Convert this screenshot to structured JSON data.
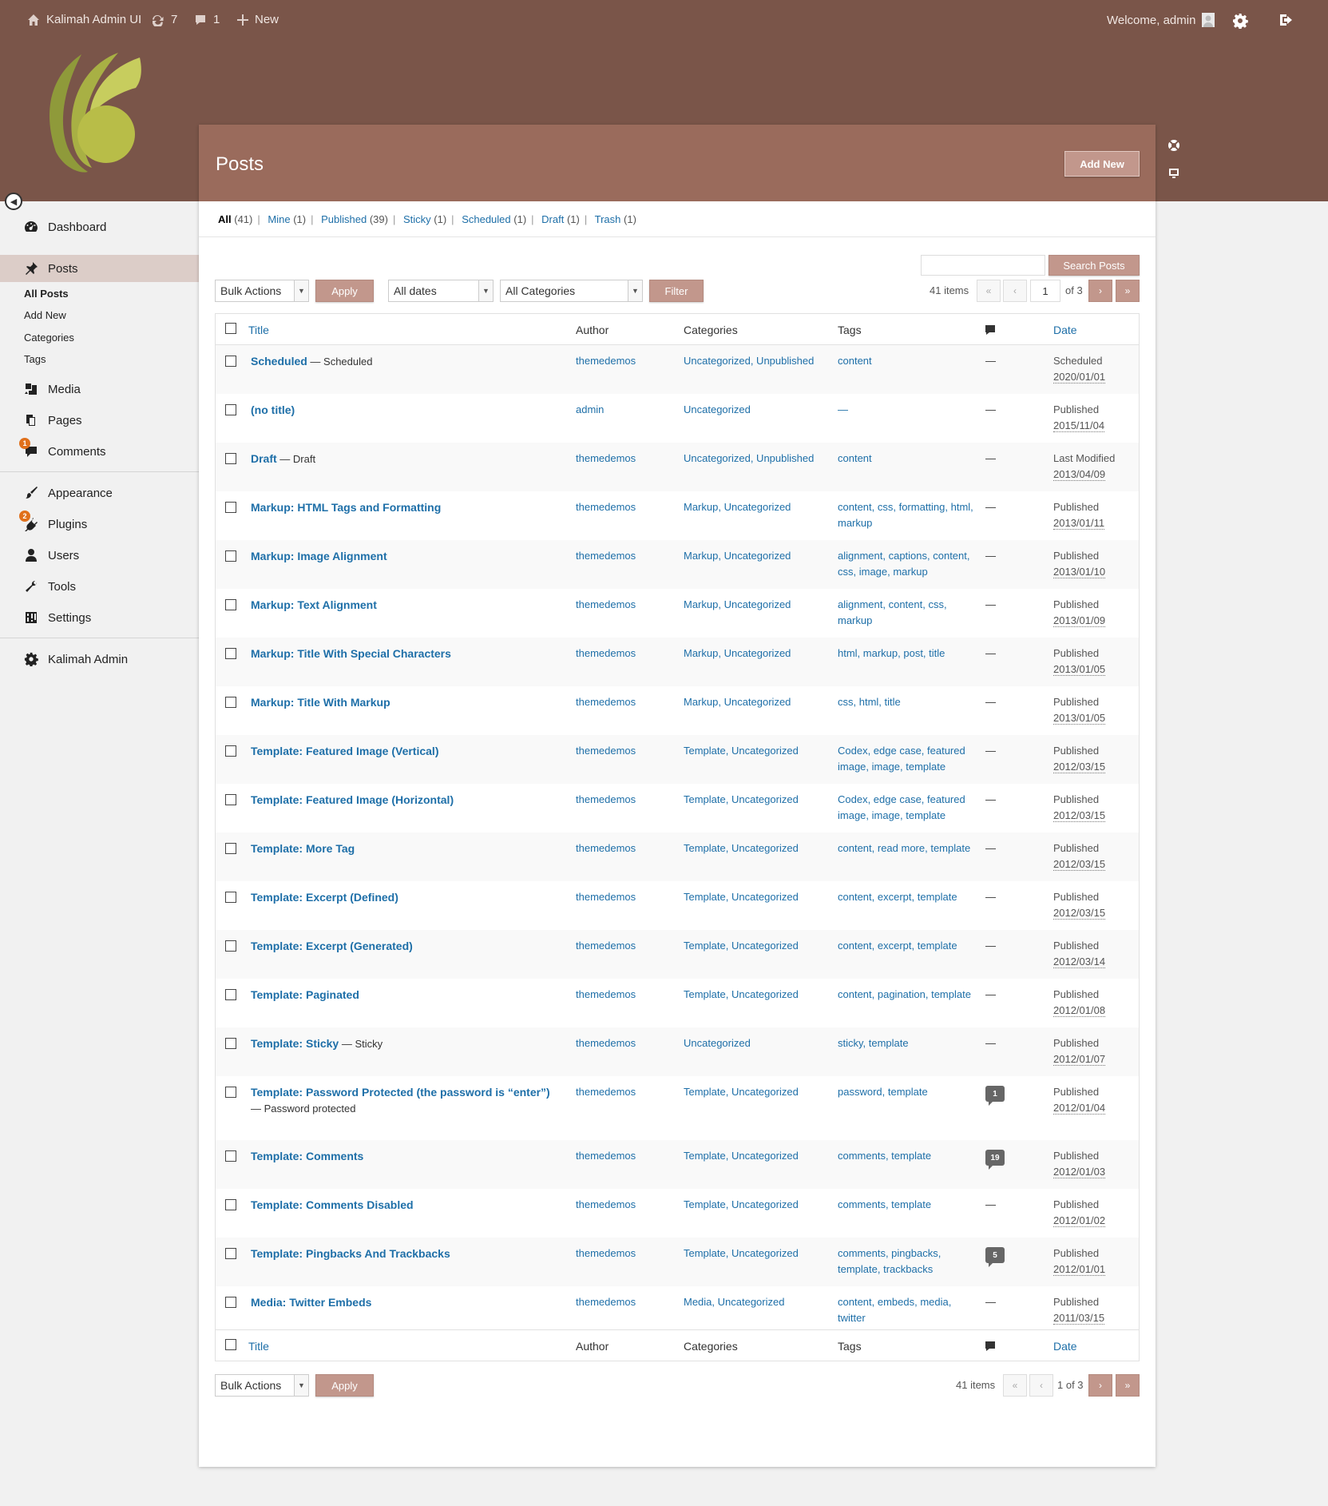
{
  "adminbar": {
    "site_name": "Kalimah Admin UI",
    "updates_count": "7",
    "comments_count": "1",
    "new_label": "New",
    "welcome": "Welcome, admin"
  },
  "sidebar": {
    "items": [
      {
        "label": "Dashboard",
        "icon": "dashboard-icon"
      },
      {
        "label": "Posts",
        "icon": "pin-icon"
      },
      {
        "label": "Media",
        "icon": "media-icon"
      },
      {
        "label": "Pages",
        "icon": "pages-icon"
      },
      {
        "label": "Comments",
        "icon": "comment-icon",
        "badge": "1"
      },
      {
        "label": "Appearance",
        "icon": "brush-icon"
      },
      {
        "label": "Plugins",
        "icon": "plugin-icon",
        "badge": "2"
      },
      {
        "label": "Users",
        "icon": "user-icon"
      },
      {
        "label": "Tools",
        "icon": "wrench-icon"
      },
      {
        "label": "Settings",
        "icon": "settings-icon"
      },
      {
        "label": "Kalimah Admin",
        "icon": "gear-icon"
      }
    ],
    "submenu": [
      "All Posts",
      "Add New",
      "Categories",
      "Tags"
    ]
  },
  "page": {
    "title": "Posts",
    "add_new": "Add New"
  },
  "status_links": [
    {
      "label": "All",
      "count": "(41)"
    },
    {
      "label": "Mine",
      "count": "(1)"
    },
    {
      "label": "Published",
      "count": "(39)"
    },
    {
      "label": "Sticky",
      "count": "(1)"
    },
    {
      "label": "Scheduled",
      "count": "(1)"
    },
    {
      "label": "Draft",
      "count": "(1)"
    },
    {
      "label": "Trash",
      "count": "(1)"
    }
  ],
  "toolbar": {
    "bulk_actions": "Bulk Actions",
    "apply": "Apply",
    "all_dates": "All dates",
    "all_categories": "All Categories",
    "filter": "Filter",
    "search_button": "Search Posts",
    "search_value": "",
    "items": "41 items",
    "current_page": "1",
    "of_pages": "of 3",
    "bottom_pages": "1 of 3",
    "first": "«",
    "prev": "‹",
    "next": "›",
    "last": "»"
  },
  "columns": {
    "title": "Title",
    "author": "Author",
    "categories": "Categories",
    "tags": "Tags",
    "date": "Date"
  },
  "posts": [
    {
      "title": "Scheduled",
      "state": " — Scheduled",
      "author": "themedemos",
      "categories": "Uncategorized, Unpublished",
      "tags": "content",
      "comments": "—",
      "status": "Scheduled",
      "date": "2020/01/01"
    },
    {
      "title": "(no title)",
      "state": "",
      "author": "admin",
      "categories": "Uncategorized",
      "tags": "—",
      "comments": "—",
      "status": "Published",
      "date": "2015/11/04"
    },
    {
      "title": "Draft",
      "state": " — Draft",
      "author": "themedemos",
      "categories": "Uncategorized, Unpublished",
      "tags": "content",
      "comments": "—",
      "status": "Last Modified",
      "date": "2013/04/09"
    },
    {
      "title": "Markup: HTML Tags and Formatting",
      "state": "",
      "author": "themedemos",
      "categories": "Markup, Uncategorized",
      "tags": "content, css, formatting, html, markup",
      "comments": "—",
      "status": "Published",
      "date": "2013/01/11"
    },
    {
      "title": "Markup: Image Alignment",
      "state": "",
      "author": "themedemos",
      "categories": "Markup, Uncategorized",
      "tags": "alignment, captions, content, css, image, markup",
      "comments": "—",
      "status": "Published",
      "date": "2013/01/10"
    },
    {
      "title": "Markup: Text Alignment",
      "state": "",
      "author": "themedemos",
      "categories": "Markup, Uncategorized",
      "tags": "alignment, content, css, markup",
      "comments": "—",
      "status": "Published",
      "date": "2013/01/09"
    },
    {
      "title": "Markup: Title With Special Characters",
      "state": "",
      "author": "themedemos",
      "categories": "Markup, Uncategorized",
      "tags": "html, markup, post, title",
      "comments": "—",
      "status": "Published",
      "date": "2013/01/05"
    },
    {
      "title": "Markup: Title With Markup",
      "state": "",
      "author": "themedemos",
      "categories": "Markup, Uncategorized",
      "tags": "css, html, title",
      "comments": "—",
      "status": "Published",
      "date": "2013/01/05"
    },
    {
      "title": "Template: Featured Image (Vertical)",
      "state": "",
      "author": "themedemos",
      "categories": "Template, Uncategorized",
      "tags": "Codex, edge case, featured image, image, template",
      "comments": "—",
      "status": "Published",
      "date": "2012/03/15"
    },
    {
      "title": "Template: Featured Image (Horizontal)",
      "state": "",
      "author": "themedemos",
      "categories": "Template, Uncategorized",
      "tags": "Codex, edge case, featured image, image, template",
      "comments": "—",
      "status": "Published",
      "date": "2012/03/15"
    },
    {
      "title": "Template: More Tag",
      "state": "",
      "author": "themedemos",
      "categories": "Template, Uncategorized",
      "tags": "content, read more, template",
      "comments": "—",
      "status": "Published",
      "date": "2012/03/15"
    },
    {
      "title": "Template: Excerpt (Defined)",
      "state": "",
      "author": "themedemos",
      "categories": "Template, Uncategorized",
      "tags": "content, excerpt, template",
      "comments": "—",
      "status": "Published",
      "date": "2012/03/15"
    },
    {
      "title": "Template: Excerpt (Generated)",
      "state": "",
      "author": "themedemos",
      "categories": "Template, Uncategorized",
      "tags": "content, excerpt, template",
      "comments": "—",
      "status": "Published",
      "date": "2012/03/14"
    },
    {
      "title": "Template: Paginated",
      "state": "",
      "author": "themedemos",
      "categories": "Template, Uncategorized",
      "tags": "content, pagination, template",
      "comments": "—",
      "status": "Published",
      "date": "2012/01/08"
    },
    {
      "title": "Template: Sticky",
      "state": " — Sticky",
      "author": "themedemos",
      "categories": "Uncategorized",
      "tags": "sticky, template",
      "comments": "—",
      "status": "Published",
      "date": "2012/01/07"
    },
    {
      "title": "Template: Password Protected (the password is “enter”)",
      "state": " — Password protected",
      "author": "themedemos",
      "categories": "Template, Uncategorized",
      "tags": "password, template",
      "comments": "1",
      "status": "Published",
      "date": "2012/01/04"
    },
    {
      "title": "Template: Comments",
      "state": "",
      "author": "themedemos",
      "categories": "Template, Uncategorized",
      "tags": "comments, template",
      "comments": "19",
      "status": "Published",
      "date": "2012/01/03"
    },
    {
      "title": "Template: Comments Disabled",
      "state": "",
      "author": "themedemos",
      "categories": "Template, Uncategorized",
      "tags": "comments, template",
      "comments": "—",
      "status": "Published",
      "date": "2012/01/02"
    },
    {
      "title": "Template: Pingbacks And Trackbacks",
      "state": "",
      "author": "themedemos",
      "categories": "Template, Uncategorized",
      "tags": "comments, pingbacks, template, trackbacks",
      "comments": "5",
      "status": "Published",
      "date": "2012/01/01"
    },
    {
      "title": "Media: Twitter Embeds",
      "state": "",
      "author": "themedemos",
      "categories": "Media, Uncategorized",
      "tags": "content, embeds, media, twitter",
      "comments": "—",
      "status": "Published",
      "date": "2011/03/15"
    }
  ],
  "colors": {
    "header": "#7a5549",
    "panel_header": "#9a6b5c",
    "accent_button": "#c2978c",
    "link": "#1e6fa8"
  }
}
